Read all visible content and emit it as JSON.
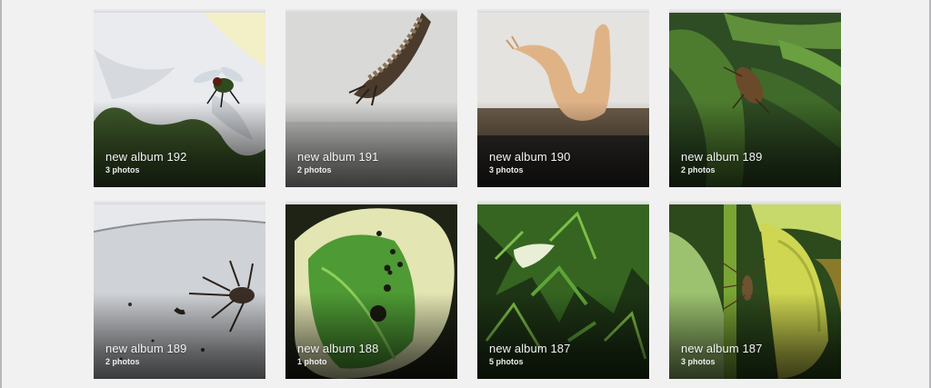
{
  "albums": [
    {
      "title": "new album 192",
      "count": "3 photos",
      "subject": "fly-on-white-flower"
    },
    {
      "title": "new album 191",
      "count": "2 photos",
      "subject": "millipede-on-wall"
    },
    {
      "title": "new album 190",
      "count": "3 photos",
      "subject": "slug-on-siding"
    },
    {
      "title": "new album 189",
      "count": "2 photos",
      "subject": "insect-on-leaves"
    },
    {
      "title": "new album 189",
      "count": "2 photos",
      "subject": "spider-on-white-surface"
    },
    {
      "title": "new album 188",
      "count": "1 photo",
      "subject": "hosta-leaf-with-holes"
    },
    {
      "title": "new album 187",
      "count": "5 photos",
      "subject": "moth-in-carrot-greens"
    },
    {
      "title": "new album 187",
      "count": "3 photos",
      "subject": "spider-on-yellow-leaf"
    }
  ]
}
